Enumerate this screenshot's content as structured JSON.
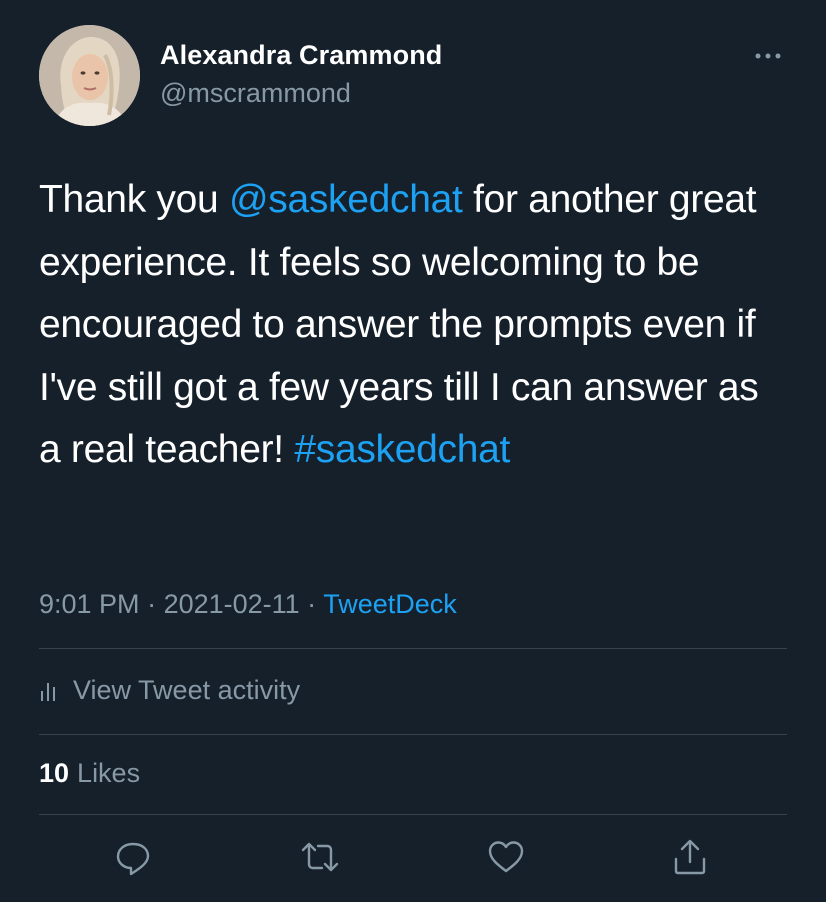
{
  "author": {
    "display_name": "Alexandra Crammond",
    "handle": "@mscrammond"
  },
  "tweet": {
    "text_1": "Thank you ",
    "mention": "@saskedchat",
    "text_2": " for another great experience. It feels so welcoming to be encouraged to answer the prompts even if I've still got a few years till I can answer as a real teacher! ",
    "hashtag": "#saskedchat",
    "time": "9:01 PM",
    "separator": " · ",
    "date": "2021-02-11",
    "source": "TweetDeck"
  },
  "activity": {
    "label": "View Tweet activity"
  },
  "likes": {
    "count": "10",
    "label": "Likes"
  },
  "icons": {
    "more": "more-horizontal-icon",
    "activity": "bar-chart-icon",
    "reply": "comment-icon",
    "retweet": "retweet-icon",
    "like": "heart-icon",
    "share": "share-icon"
  },
  "colors": {
    "background": "#15202b",
    "text": "#ffffff",
    "secondary": "#8899a6",
    "accent": "#1da1f2",
    "divider": "#38444d"
  }
}
